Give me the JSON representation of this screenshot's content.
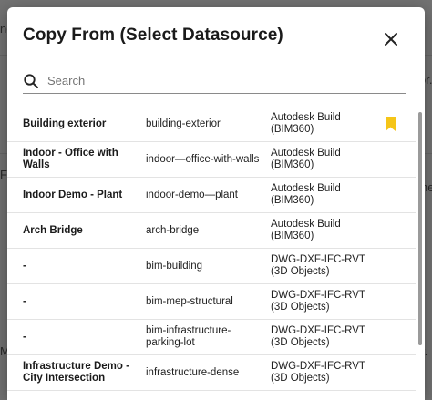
{
  "background": {
    "left_fragment_top": "ne",
    "left_fragment_mid": "FT",
    "left_fragment_bottom": "M",
    "right_fragment_top": "or.",
    "right_fragment_mid": "ne",
    "right_fragment_bottom": "r."
  },
  "dialog": {
    "title": "Copy From (Select Datasource)",
    "close_icon": "close-icon",
    "search": {
      "placeholder": "Search",
      "value": "",
      "icon": "search-icon"
    }
  },
  "colors": {
    "bookmark": "#f5c518",
    "scrim": "#6e6e6e",
    "dialog": "#ffffff"
  },
  "datasources": [
    {
      "name": "Building exterior",
      "slug": "building-exterior",
      "type": "Autodesk Build (BIM360)",
      "bookmarked": true
    },
    {
      "name": "Indoor - Office with Walls",
      "slug": "indoor—office-with-walls",
      "type": "Autodesk Build (BIM360)",
      "bookmarked": false
    },
    {
      "name": "Indoor Demo - Plant",
      "slug": "indoor-demo—plant",
      "type": "Autodesk Build (BIM360)",
      "bookmarked": false
    },
    {
      "name": "Arch Bridge",
      "slug": "arch-bridge",
      "type": "Autodesk Build (BIM360)",
      "bookmarked": false
    },
    {
      "name": "-",
      "slug": "bim-building",
      "type": "DWG-DXF-IFC-RVT (3D Objects)",
      "bookmarked": false
    },
    {
      "name": "-",
      "slug": "bim-mep-structural",
      "type": "DWG-DXF-IFC-RVT (3D Objects)",
      "bookmarked": false
    },
    {
      "name": "-",
      "slug": "bim-infrastructure-parking-lot",
      "type": "DWG-DXF-IFC-RVT (3D Objects)",
      "bookmarked": false
    },
    {
      "name": "Infrastructure Demo - City Intersection",
      "slug": "infrastructure-dense",
      "type": "DWG-DXF-IFC-RVT (3D Objects)",
      "bookmarked": false
    }
  ]
}
